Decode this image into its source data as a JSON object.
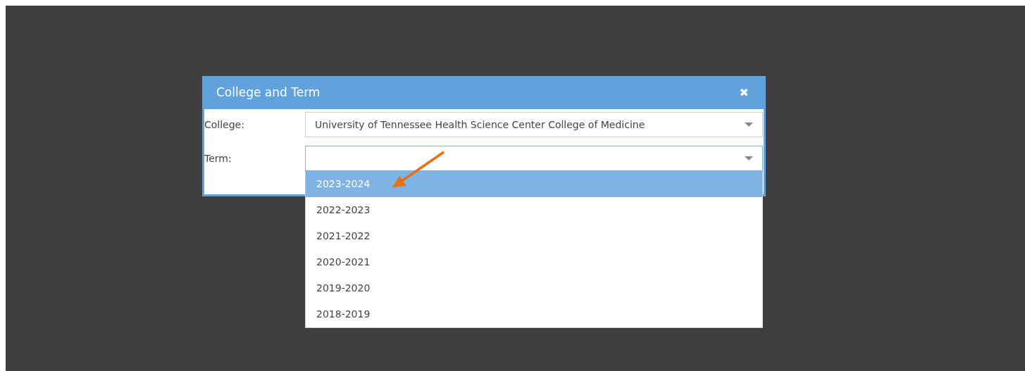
{
  "dialog": {
    "title": "College and Term",
    "close_icon": "✖"
  },
  "fields": [
    {
      "label": "College:",
      "value": "University of Tennessee Health Science Center College of Medicine",
      "focused": false
    },
    {
      "label": "Term:",
      "focused": true
    }
  ],
  "dropdown": {
    "options": [
      {
        "label": "2023-2024",
        "selected": true
      },
      {
        "label": "2022-2023",
        "selected": false
      },
      {
        "label": "2021-2022",
        "selected": false
      },
      {
        "label": "2020-2021",
        "selected": false
      },
      {
        "label": "2019-2020",
        "selected": false
      },
      {
        "label": "2018-2019",
        "selected": false
      }
    ]
  }
}
